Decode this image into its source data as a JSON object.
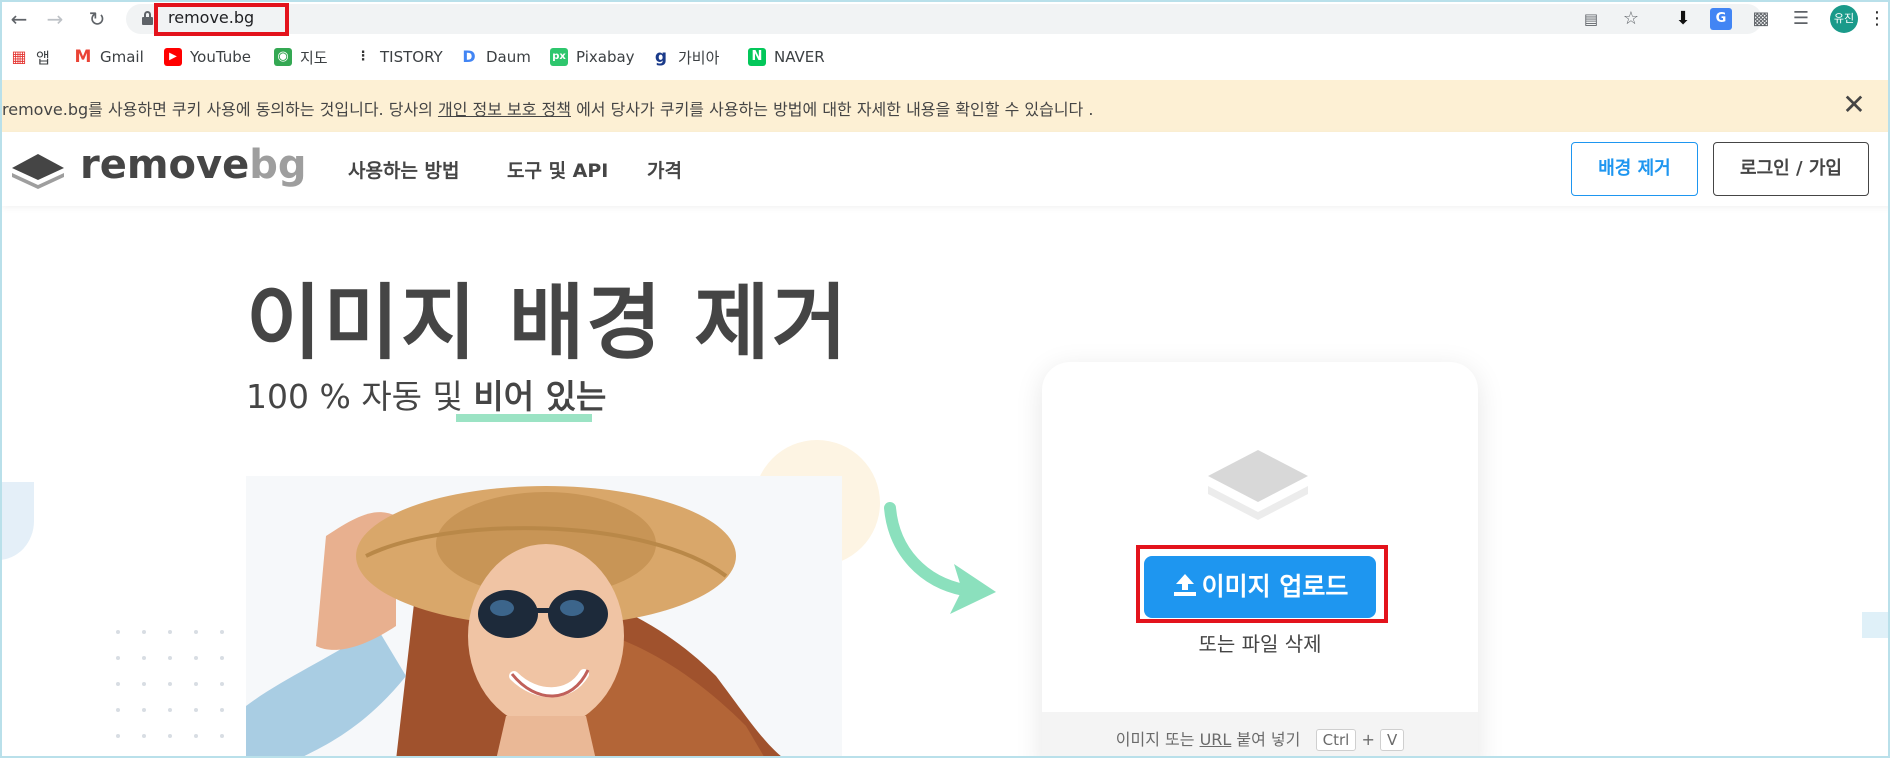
{
  "browser": {
    "url": "remove.bg",
    "profile_initial": "유진",
    "icons": [
      "back-arrow-icon",
      "forward-arrow-icon",
      "reload-icon",
      "lock-icon",
      "translate-icon",
      "star-icon",
      "extension-download-icon",
      "google-translate-icon",
      "puzzle-icon",
      "playlist-icon",
      "more-menu-icon"
    ]
  },
  "bookmarks": [
    {
      "label": "앱",
      "icon": "apps-grid-icon",
      "color": "#e53935"
    },
    {
      "label": "Gmail",
      "icon": "gmail-icon",
      "color": "#ea4335"
    },
    {
      "label": "YouTube",
      "icon": "youtube-icon",
      "color": "#ff0000"
    },
    {
      "label": "지도",
      "icon": "maps-icon",
      "color": "#34a853"
    },
    {
      "label": "TISTORY",
      "icon": "tistory-icon",
      "color": "#333333"
    },
    {
      "label": "Daum",
      "icon": "daum-icon",
      "color": "#4285f4"
    },
    {
      "label": "Pixabay",
      "icon": "pixabay-icon",
      "color": "#2ec66d"
    },
    {
      "label": "가비아",
      "icon": "gabia-icon",
      "color": "#1a3a8a"
    },
    {
      "label": "NAVER",
      "icon": "naver-icon",
      "color": "#03c75a"
    }
  ],
  "cookie_banner": {
    "text_before": "remove.bg를 사용하면 쿠키 사용에 동의하는 것입니다. 당사의 ",
    "link": "개인 정보 보호 정책",
    "text_after": " 에서 당사가 쿠키를 사용하는 방법에 대한 자세한 내용을 확인할 수 있습니다 ."
  },
  "header": {
    "logo_main": "remove",
    "logo_accent": "bg",
    "nav": [
      "사용하는 방법",
      "도구 및 API",
      "가격"
    ],
    "remove_bg_button": "배경 제거",
    "login_button": "로그인 / 가입"
  },
  "hero": {
    "title": "이미지 배경 제거",
    "subtitle_plain": "100 % 자동 및 ",
    "subtitle_strong": "비어 있는"
  },
  "upload_card": {
    "upload_button": "이미지 업로드",
    "drop_text": "또는 파일 삭제",
    "paste_prefix": "이미지 또는 ",
    "paste_url": "URL",
    "paste_suffix": " 붙여 넣기",
    "key_ctrl": "Ctrl",
    "key_plus": "+",
    "key_v": "V"
  },
  "colors": {
    "accent_blue": "#1e96f0",
    "highlight_red": "#e3131c",
    "underline_green": "#9be3c4",
    "cookie_bg": "#fdf0d4"
  }
}
